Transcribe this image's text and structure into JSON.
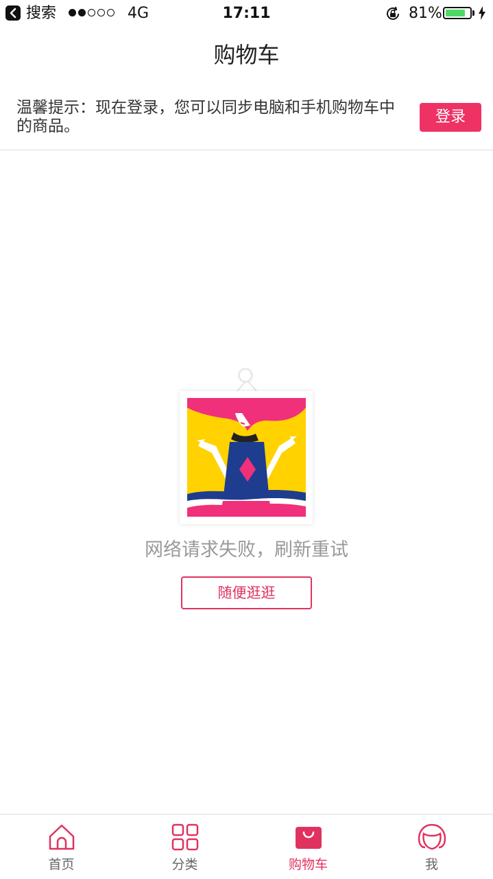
{
  "status_bar": {
    "back_label": "搜索",
    "network": "4G",
    "time": "17:11",
    "battery_percent": "81%",
    "battery_level": 0.81,
    "signal_bars_filled": 2,
    "signal_bars_total": 5
  },
  "header": {
    "title": "购物车"
  },
  "login_notice": {
    "text": "温馨提示：现在登录，您可以同步电脑和手机购物车中的商品。",
    "button_label": "登录"
  },
  "empty_state": {
    "message": "网络请求失败，刷新重试",
    "button_label": "随便逛逛"
  },
  "tab_bar": {
    "items": [
      {
        "label": "首页",
        "icon": "home-icon"
      },
      {
        "label": "分类",
        "icon": "grid-icon"
      },
      {
        "label": "购物车",
        "icon": "shopping-bag-icon",
        "active": true
      },
      {
        "label": "我",
        "icon": "profile-icon"
      }
    ]
  },
  "colors": {
    "accent": "#e0325e",
    "button_fill": "#ee3264",
    "battery": "#4cd964"
  }
}
